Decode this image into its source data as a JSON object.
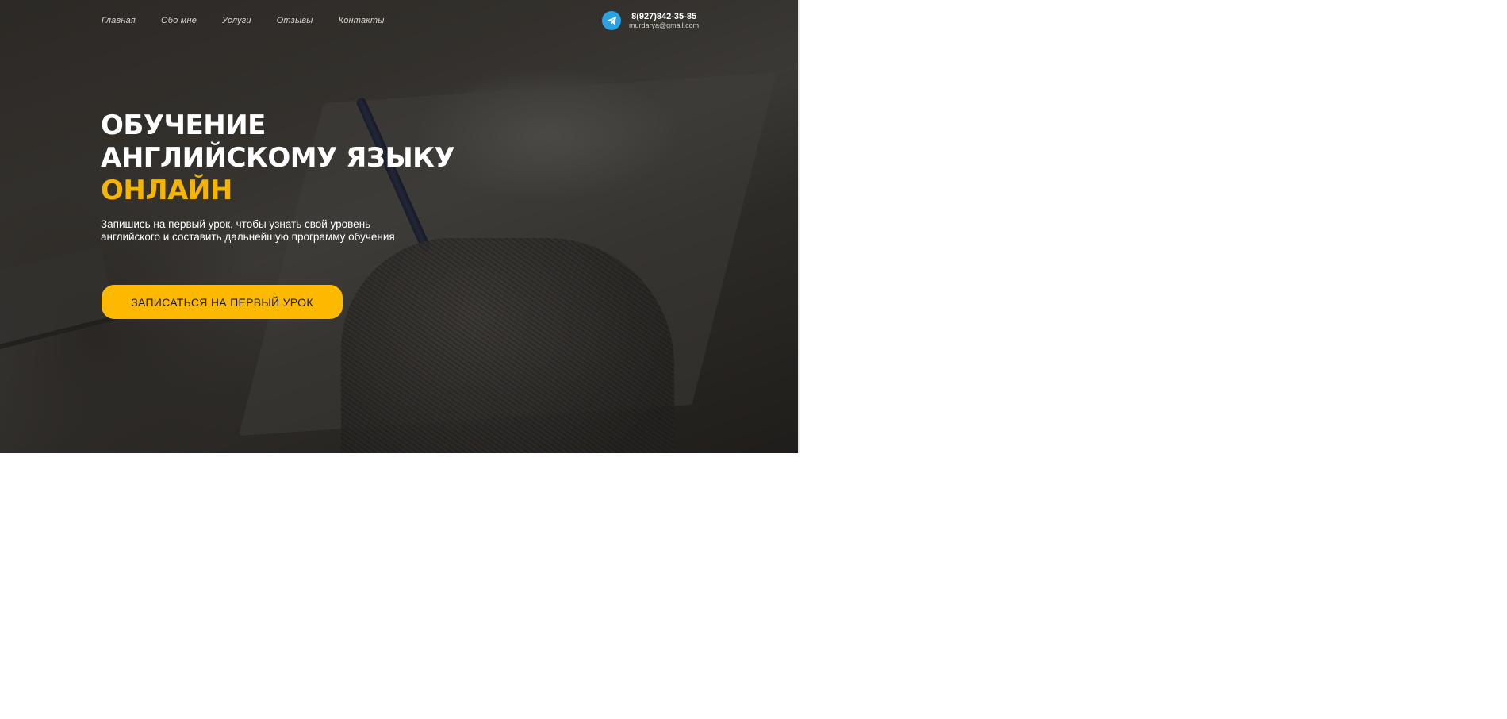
{
  "nav": {
    "items": [
      {
        "label": "Главная"
      },
      {
        "label": "Обо мне"
      },
      {
        "label": "Услуги"
      },
      {
        "label": "Отзывы"
      },
      {
        "label": "Контакты"
      }
    ]
  },
  "contact": {
    "phone": "8(927)842-35-85",
    "email": "murdarya@gmail.com",
    "icon": "telegram-icon"
  },
  "hero": {
    "title_line1": "ОБУЧЕНИЕ",
    "title_line2": "АНГЛИЙСКОМУ ЯЗЫКУ",
    "title_accent": "ОНЛАЙН",
    "subtitle_line1": "Запишись на первый урок, чтобы узнать свой уровень",
    "subtitle_line2": "английского и составить дальнейшую программу обучения",
    "cta_label": "ЗАПИСАТЬСЯ НА ПЕРВЫЙ УРОК"
  },
  "colors": {
    "accent": "#f4b400",
    "button": "#fcb900",
    "telegram": "#2aa3e0"
  }
}
